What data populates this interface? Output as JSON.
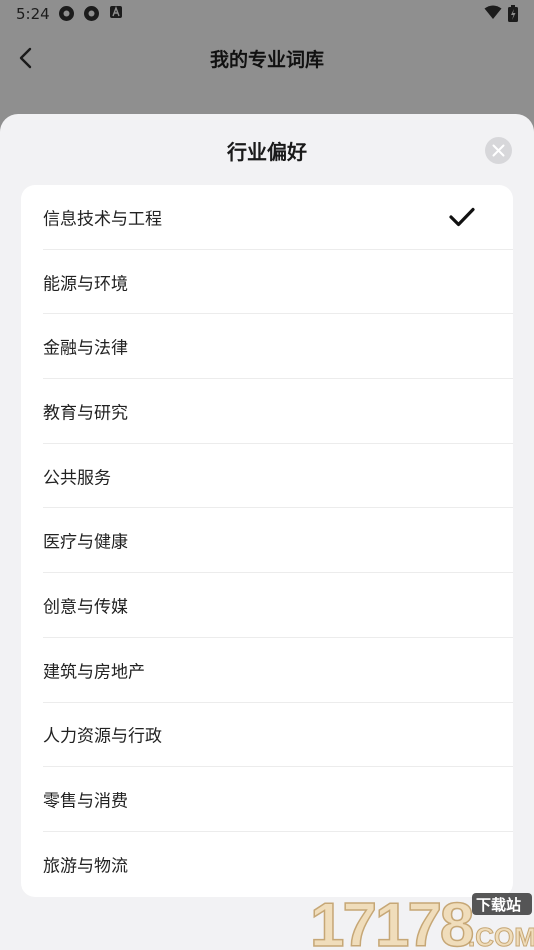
{
  "status_bar": {
    "time": "5:24"
  },
  "header": {
    "title": "我的专业词库"
  },
  "sheet": {
    "title": "行业偏好",
    "items": [
      {
        "label": "信息技术与工程",
        "selected": true
      },
      {
        "label": "能源与环境",
        "selected": false
      },
      {
        "label": "金融与法律",
        "selected": false
      },
      {
        "label": "教育与研究",
        "selected": false
      },
      {
        "label": "公共服务",
        "selected": false
      },
      {
        "label": "医疗与健康",
        "selected": false
      },
      {
        "label": "创意与传媒",
        "selected": false
      },
      {
        "label": "建筑与房地产",
        "selected": false
      },
      {
        "label": "人力资源与行政",
        "selected": false
      },
      {
        "label": "零售与消费",
        "selected": false
      },
      {
        "label": "旅游与物流",
        "selected": false
      }
    ]
  },
  "watermark": {
    "number": "17178",
    "tag": "下载站",
    "domain": ".COM"
  },
  "colors": {
    "overlay": "#8f8f8f",
    "sheet_bg": "#f2f2f4",
    "list_bg": "#ffffff",
    "accent": "#111111"
  }
}
